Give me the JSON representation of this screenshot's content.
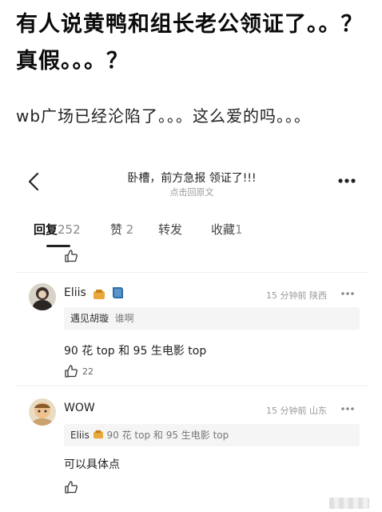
{
  "post": {
    "title": "有人说黄鸭和组长老公领证了。。？真假。。。？",
    "body": "wb广场已经沦陷了。。。这么爱的吗。。。"
  },
  "screenshot": {
    "nav": {
      "title": "卧槽，前方急报 领证了!!!",
      "subtitle": "点击回原文"
    },
    "tabs": [
      {
        "label": "回复",
        "count": "252"
      },
      {
        "label": "赞",
        "count": "2"
      },
      {
        "label": "转发",
        "count": ""
      },
      {
        "label": "收藏",
        "count": "1"
      }
    ],
    "comments": [
      {
        "username": "Eliis",
        "time": "15 分钟前",
        "location": "陕西",
        "quote_user": "遇见胡璇",
        "quote_text": "谁啊",
        "text": "90 花 top 和 95 生电影 top",
        "likes": "22"
      },
      {
        "username": "WOW",
        "time": "15 分钟前",
        "location": "山东",
        "quote_user": "Eliis",
        "quote_text": "90 花 top 和 95 生电影 top",
        "text": "可以具体点",
        "likes": ""
      }
    ]
  },
  "colors": {
    "accent_badge": "#e9a83a",
    "book_icon": "#2b6ea8"
  },
  "icons": [
    "back-icon",
    "more-icon",
    "thumbs-up-icon",
    "badge-icon",
    "book-icon"
  ]
}
